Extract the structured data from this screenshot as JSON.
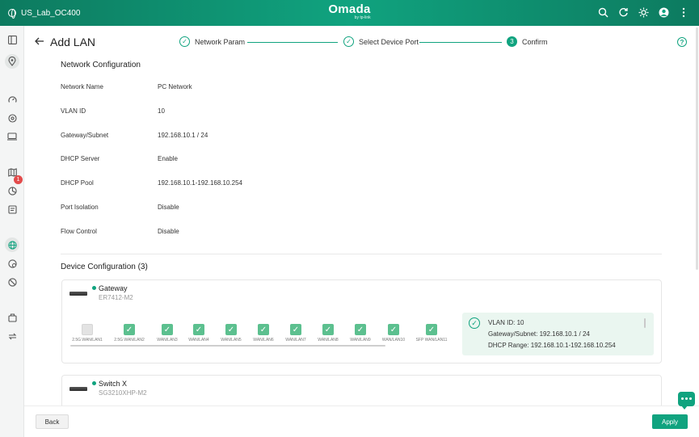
{
  "topbar": {
    "site_name": "US_Lab_OC400",
    "brand": "Omada",
    "brand_sub": "by tp-link"
  },
  "sidebar": {
    "badge_count": "1"
  },
  "header": {
    "title": "Add LAN"
  },
  "stepper": {
    "steps": [
      {
        "label": "Network Param",
        "marker": "✓",
        "state": "done"
      },
      {
        "label": "Select Device Port",
        "marker": "✓",
        "state": "done"
      },
      {
        "label": "Confirm",
        "marker": "3",
        "state": "current"
      }
    ]
  },
  "network_config": {
    "title": "Network Configuration",
    "rows": [
      {
        "label": "Network Name",
        "value": "PC Network"
      },
      {
        "label": "VLAN ID",
        "value": "10"
      },
      {
        "label": "Gateway/Subnet",
        "value": "192.168.10.1 / 24"
      },
      {
        "label": "DHCP Server",
        "value": "Enable"
      },
      {
        "label": "DHCP Pool",
        "value": "192.168.10.1-192.168.10.254"
      },
      {
        "label": "Port Isolation",
        "value": "Disable"
      },
      {
        "label": "Flow Control",
        "value": "Disable"
      }
    ]
  },
  "device_config": {
    "title": "Device Configuration (3)",
    "devices": [
      {
        "name": "Gateway",
        "model": "ER7412-M2",
        "ports": [
          {
            "label": "2.5G WAN/LAN1",
            "selected": false
          },
          {
            "label": "2.5G WAN/LAN2",
            "selected": true
          },
          {
            "label": "WAN/LAN3",
            "selected": true
          },
          {
            "label": "WAN/LAN4",
            "selected": true
          },
          {
            "label": "WAN/LAN5",
            "selected": true
          },
          {
            "label": "WAN/LAN6",
            "selected": true
          },
          {
            "label": "WAN/LAN7",
            "selected": true
          },
          {
            "label": "WAN/LAN8",
            "selected": true
          },
          {
            "label": "WAN/LAN9",
            "selected": true
          },
          {
            "label": "WAN/LAN10",
            "selected": true
          },
          {
            "label": "SFP WAN/LAN11",
            "selected": true
          }
        ],
        "info": [
          "VLAN ID: 10",
          "Gateway/Subnet: 192.168.10.1 / 24",
          "DHCP Range: 192.168.10.1-192.168.10.254"
        ]
      },
      {
        "name": "Switch X",
        "model": "SG3210XHP-M2"
      }
    ]
  },
  "footer": {
    "back_label": "Back",
    "apply_label": "Apply"
  },
  "colors": {
    "accent": "#10a37f",
    "port_selected": "#5cc08f",
    "badge": "#e34b4b"
  }
}
